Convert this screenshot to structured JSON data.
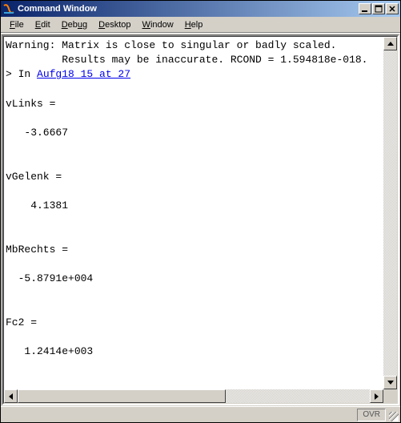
{
  "window": {
    "title": "Command Window"
  },
  "menubar": {
    "items": [
      {
        "full": "File",
        "accel": "F"
      },
      {
        "full": "Edit",
        "accel": "E"
      },
      {
        "full": "Debug",
        "accel": "D"
      },
      {
        "full": "Desktop",
        "accel": "D"
      },
      {
        "full": "Window",
        "accel": "W"
      },
      {
        "full": "Help",
        "accel": "H"
      }
    ]
  },
  "console": {
    "warning_l1": "Warning: Matrix is close to singular or badly scaled.",
    "warning_l2": "         Results may be inaccurate. RCOND = 1.594818e-018.",
    "in_prefix": "> In ",
    "link_text": "Aufg18_15 at 27",
    "vars": [
      {
        "name": "vLinks",
        "value": "   -3.6667"
      },
      {
        "name": "vGelenk",
        "value": "    4.1381"
      },
      {
        "name": "MbRechts",
        "value": "  -5.8791e+004"
      },
      {
        "name": "Fc2",
        "value": "   1.2414e+003"
      }
    ],
    "prompt": ">> "
  },
  "status": {
    "ovr": "OVR"
  }
}
